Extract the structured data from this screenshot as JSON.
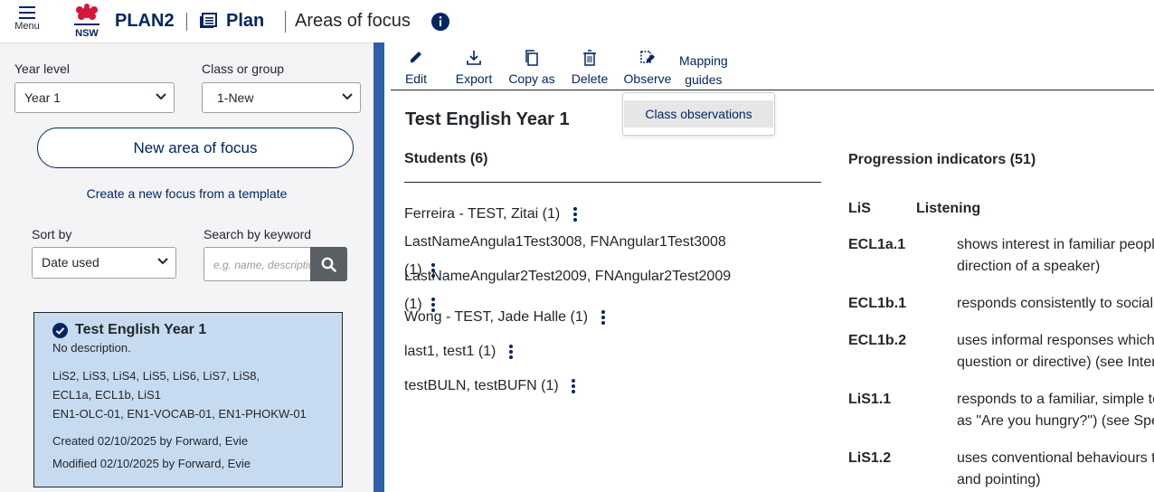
{
  "header": {
    "menu_label": "Menu",
    "app_name": "PLAN2",
    "plan_label": "Plan",
    "page_title": "Areas of focus"
  },
  "sidebar": {
    "year_level_label": "Year level",
    "year_level_value": "Year 1",
    "class_label": "Class or group",
    "class_value": "1-New",
    "new_area_button": "New area of focus",
    "template_link": "Create a new focus from a template",
    "sort_label": "Sort by",
    "sort_value": "Date used",
    "search_label": "Search by keyword",
    "search_placeholder": "e.g. name, description"
  },
  "focus_card": {
    "title": "Test English Year 1",
    "description": "No description.",
    "tags_line1": "LiS2,  LiS3,  LiS4,  LiS5,  LiS6,  LiS7,  LiS8,",
    "tags_line2": "ECL1a,  ECL1b,  LiS1",
    "tags_line3": "EN1-OLC-01,  EN1-VOCAB-01,  EN1-PHOKW-01",
    "created": "Created 02/10/2025 by Forward, Evie",
    "modified": "Modified 02/10/2025 by Forward, Evie"
  },
  "toolbar": {
    "edit": "Edit",
    "export": "Export",
    "copy_as": "Copy as",
    "delete": "Delete",
    "observe": "Observe",
    "mapping_line1": "Mapping",
    "mapping_line2": "guides"
  },
  "observe_menu": {
    "item": "Class observations"
  },
  "main": {
    "title": "Test English Year 1",
    "students_heading": "Students (6)",
    "students": [
      "Ferreira - TEST, Zitai (1)",
      "LastNameAngula1Test3008, FNAngular1Test3008",
      "(1)",
      "LastNameAngular2Test2009, FNAngular2Test2009",
      "(1)",
      "Wong - TEST, Jade Halle (1)",
      "last1, test1 (1)",
      "testBULN, testBUFN (1)"
    ],
    "pi_heading": "Progression indicators (51)",
    "pi_group_code": "LiS",
    "pi_group_name": "Listening",
    "indicators": [
      {
        "code": "ECL1a.1",
        "line1": "shows interest in familiar peopl",
        "line2": "direction of a speaker)"
      },
      {
        "code": "ECL1b.1",
        "line1": "responds consistently to social",
        "line2": ""
      },
      {
        "code": "ECL1b.2",
        "line1": "uses informal responses which",
        "line2": "question or directive) (see Inter"
      },
      {
        "code": "LiS1.1",
        "line1": "responds to a familiar, simple te",
        "line2": "as \"Are you hungry?\") (see Spe"
      },
      {
        "code": "LiS1.2",
        "line1": "uses conventional behaviours t",
        "line2": "and pointing)"
      }
    ]
  },
  "colors": {
    "brand_navy": "#002664",
    "divider_blue": "#2e5fa8",
    "card_bg": "#c7dbf0",
    "search_button": "#5a5f63"
  }
}
